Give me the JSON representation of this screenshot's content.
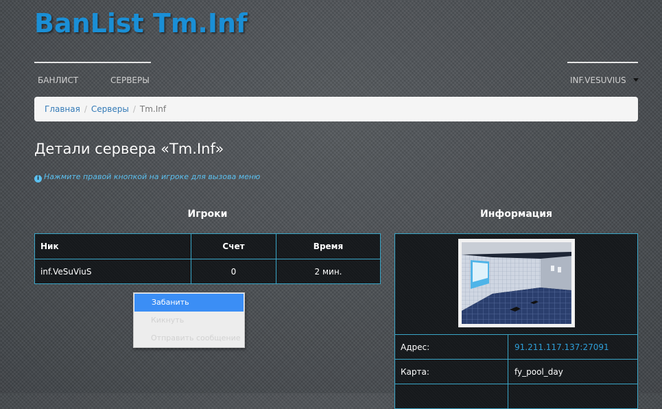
{
  "header": {
    "logo": "BanList Tm.Inf",
    "nav": {
      "banlist": "БАНЛИСТ",
      "servers": "СЕРВЕРЫ",
      "user": "INF.VESUVIUS"
    }
  },
  "breadcrumb": {
    "home": "Главная",
    "servers": "Серверы",
    "current": "Tm.Inf",
    "separator": "/"
  },
  "page": {
    "title": "Детали сервера «Tm.Inf»",
    "hint": "Нажмите правой кнопкой на игроке для вызова меню",
    "hint_icon": "i"
  },
  "players": {
    "heading": "Игроки",
    "columns": [
      "Ник",
      "Счет",
      "Время"
    ],
    "rows": [
      {
        "nick": "inf.VeSuViuS",
        "score": "0",
        "time": "2 мин."
      }
    ]
  },
  "info": {
    "heading": "Информация",
    "rows": [
      {
        "label": "Адрес:",
        "value": "91.211.117.137:27091"
      },
      {
        "label": "Карта:",
        "value": "fy_pool_day"
      }
    ]
  },
  "context_menu": {
    "items": [
      {
        "label": "Забанить",
        "state": "active"
      },
      {
        "label": "Кикнуть",
        "state": "disabled"
      },
      {
        "label": "Отправить сообщение",
        "state": "disabled"
      }
    ]
  },
  "colors": {
    "logo": "#1a8fd6",
    "accent": "#3aa7c9",
    "link": "#2e9fd8",
    "menu_active": "#3b8ef5"
  }
}
